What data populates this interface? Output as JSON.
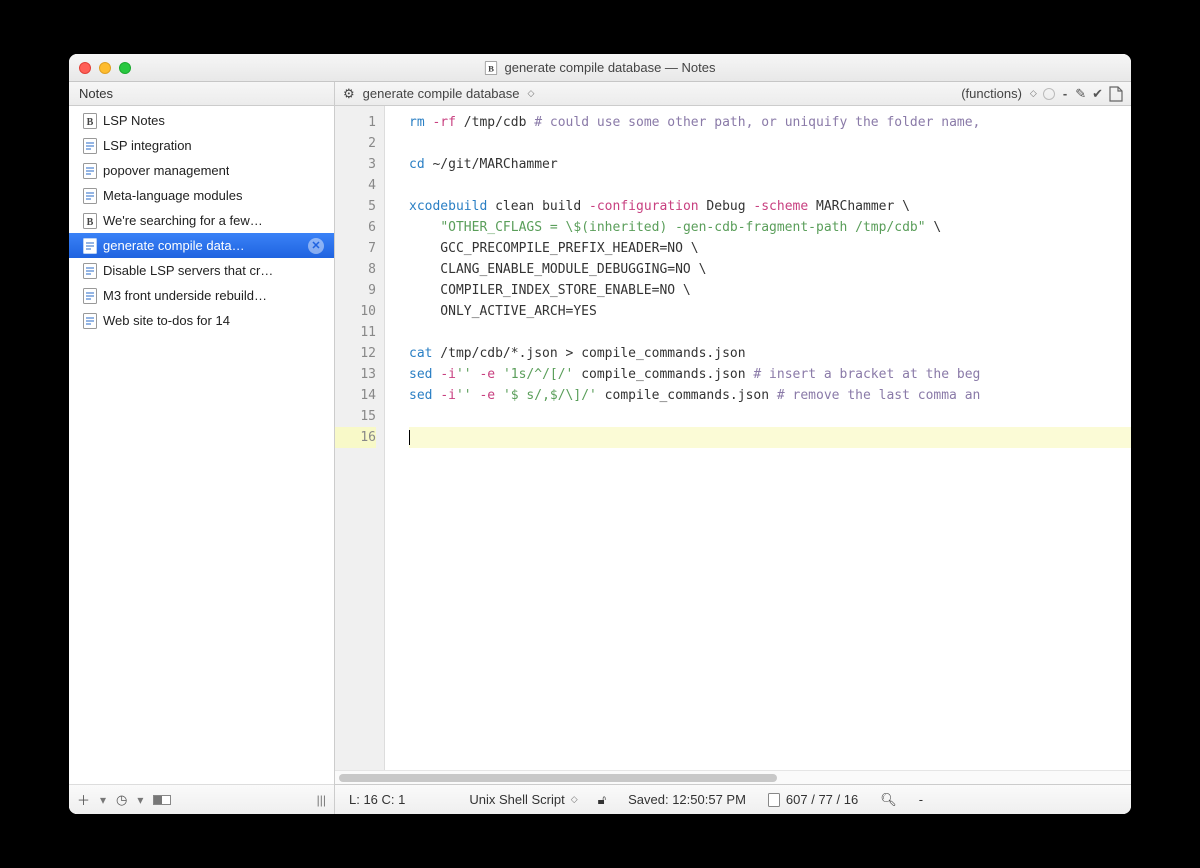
{
  "window": {
    "title": "generate compile database — Notes"
  },
  "sidebar": {
    "header": "Notes",
    "items": [
      {
        "label": "LSP Notes",
        "icon": "b"
      },
      {
        "label": "LSP integration",
        "icon": "t"
      },
      {
        "label": "popover management",
        "icon": "t"
      },
      {
        "label": "Meta-language modules",
        "icon": "t"
      },
      {
        "label": "We're searching for a few…",
        "icon": "b"
      },
      {
        "label": "generate compile data…",
        "icon": "t",
        "selected": true
      },
      {
        "label": "Disable LSP servers that cr…",
        "icon": "t"
      },
      {
        "label": "M3 front underside rebuild…",
        "icon": "t"
      },
      {
        "label": "Web site to-dos for 14",
        "icon": "t"
      }
    ]
  },
  "nav": {
    "doc_name": "generate compile database",
    "functions_label": "(functions)"
  },
  "code": {
    "lines": [
      [
        [
          "cmd",
          "rm"
        ],
        [
          "flag",
          " -rf"
        ],
        [
          "",
          " /tmp/cdb "
        ],
        [
          "comment",
          "# could use some other path, or uniquify the folder name,"
        ]
      ],
      [],
      [
        [
          "cmd",
          "cd"
        ],
        [
          "",
          " ~/git/MARChammer"
        ]
      ],
      [],
      [
        [
          "cmd",
          "xcodebuild"
        ],
        [
          "",
          " clean build "
        ],
        [
          "flag",
          "-configuration"
        ],
        [
          "",
          " Debug "
        ],
        [
          "flag",
          "-scheme"
        ],
        [
          "",
          " MARChammer \\"
        ]
      ],
      [
        [
          "",
          "    "
        ],
        [
          "str",
          "\"OTHER_CFLAGS = \\$(inherited) -gen-cdb-fragment-path /tmp/cdb\""
        ],
        [
          "",
          " \\"
        ]
      ],
      [
        [
          "",
          "    GCC_PRECOMPILE_PREFIX_HEADER=NO \\"
        ]
      ],
      [
        [
          "",
          "    CLANG_ENABLE_MODULE_DEBUGGING=NO \\"
        ]
      ],
      [
        [
          "",
          "    COMPILER_INDEX_STORE_ENABLE=NO \\"
        ]
      ],
      [
        [
          "",
          "    ONLY_ACTIVE_ARCH=YES"
        ]
      ],
      [],
      [
        [
          "cmd",
          "cat"
        ],
        [
          "",
          " /tmp/cdb/*.json > compile_commands.json"
        ]
      ],
      [
        [
          "cmd",
          "sed"
        ],
        [
          "",
          " "
        ],
        [
          "flag",
          "-i"
        ],
        [
          "str",
          "''"
        ],
        [
          "",
          " "
        ],
        [
          "flag",
          "-e"
        ],
        [
          "",
          " "
        ],
        [
          "str",
          "'1s/^/[/'"
        ],
        [
          "",
          " compile_commands.json "
        ],
        [
          "comment",
          "# insert a bracket at the beg"
        ]
      ],
      [
        [
          "cmd",
          "sed"
        ],
        [
          "",
          " "
        ],
        [
          "flag",
          "-i"
        ],
        [
          "str",
          "''"
        ],
        [
          "",
          " "
        ],
        [
          "flag",
          "-e"
        ],
        [
          "",
          " "
        ],
        [
          "str",
          "'$ s/,$/\\]/'"
        ],
        [
          "",
          " compile_commands.json "
        ],
        [
          "comment",
          "# remove the last comma an"
        ]
      ],
      [],
      []
    ],
    "current_line": 16
  },
  "status": {
    "pos": "L: 16 C: 1",
    "lang": "Unix Shell Script",
    "saved": "Saved: 12:50:57 PM",
    "counts": "607 / 77 / 16",
    "zoom": "-"
  }
}
